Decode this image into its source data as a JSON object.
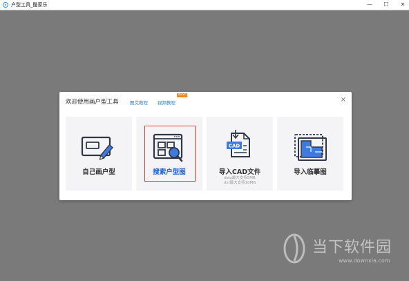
{
  "window": {
    "title": "户型工具_酷家乐",
    "controls": {
      "minimize": "—",
      "maximize": "☐",
      "close": "✕"
    }
  },
  "dialog": {
    "title": "欢迎使用画户型工具",
    "links": [
      {
        "label": "图文教程"
      },
      {
        "label": "视频教程",
        "badge": "NEW"
      }
    ],
    "close": "×",
    "cards": [
      {
        "label": "自己画户型",
        "icon": "draw-floorplan-icon"
      },
      {
        "label": "搜索户型图",
        "icon": "search-floorplan-icon",
        "selected": true
      },
      {
        "label": "导入CAD文件",
        "icon": "cad-file-icon",
        "notes": [
          "dwg最大支持5MB",
          "dxf最大支持10MB"
        ]
      },
      {
        "label": "导入临摹图",
        "icon": "trace-image-icon"
      }
    ]
  },
  "watermark": {
    "brand": "当下软件园",
    "url": "www.downxia.com"
  },
  "colors": {
    "accent": "#2a7fd6",
    "icon_blue": "#3d7be0",
    "selection": "#e23a3a",
    "badge": "#f08a24",
    "background": "#7a7a7a"
  }
}
